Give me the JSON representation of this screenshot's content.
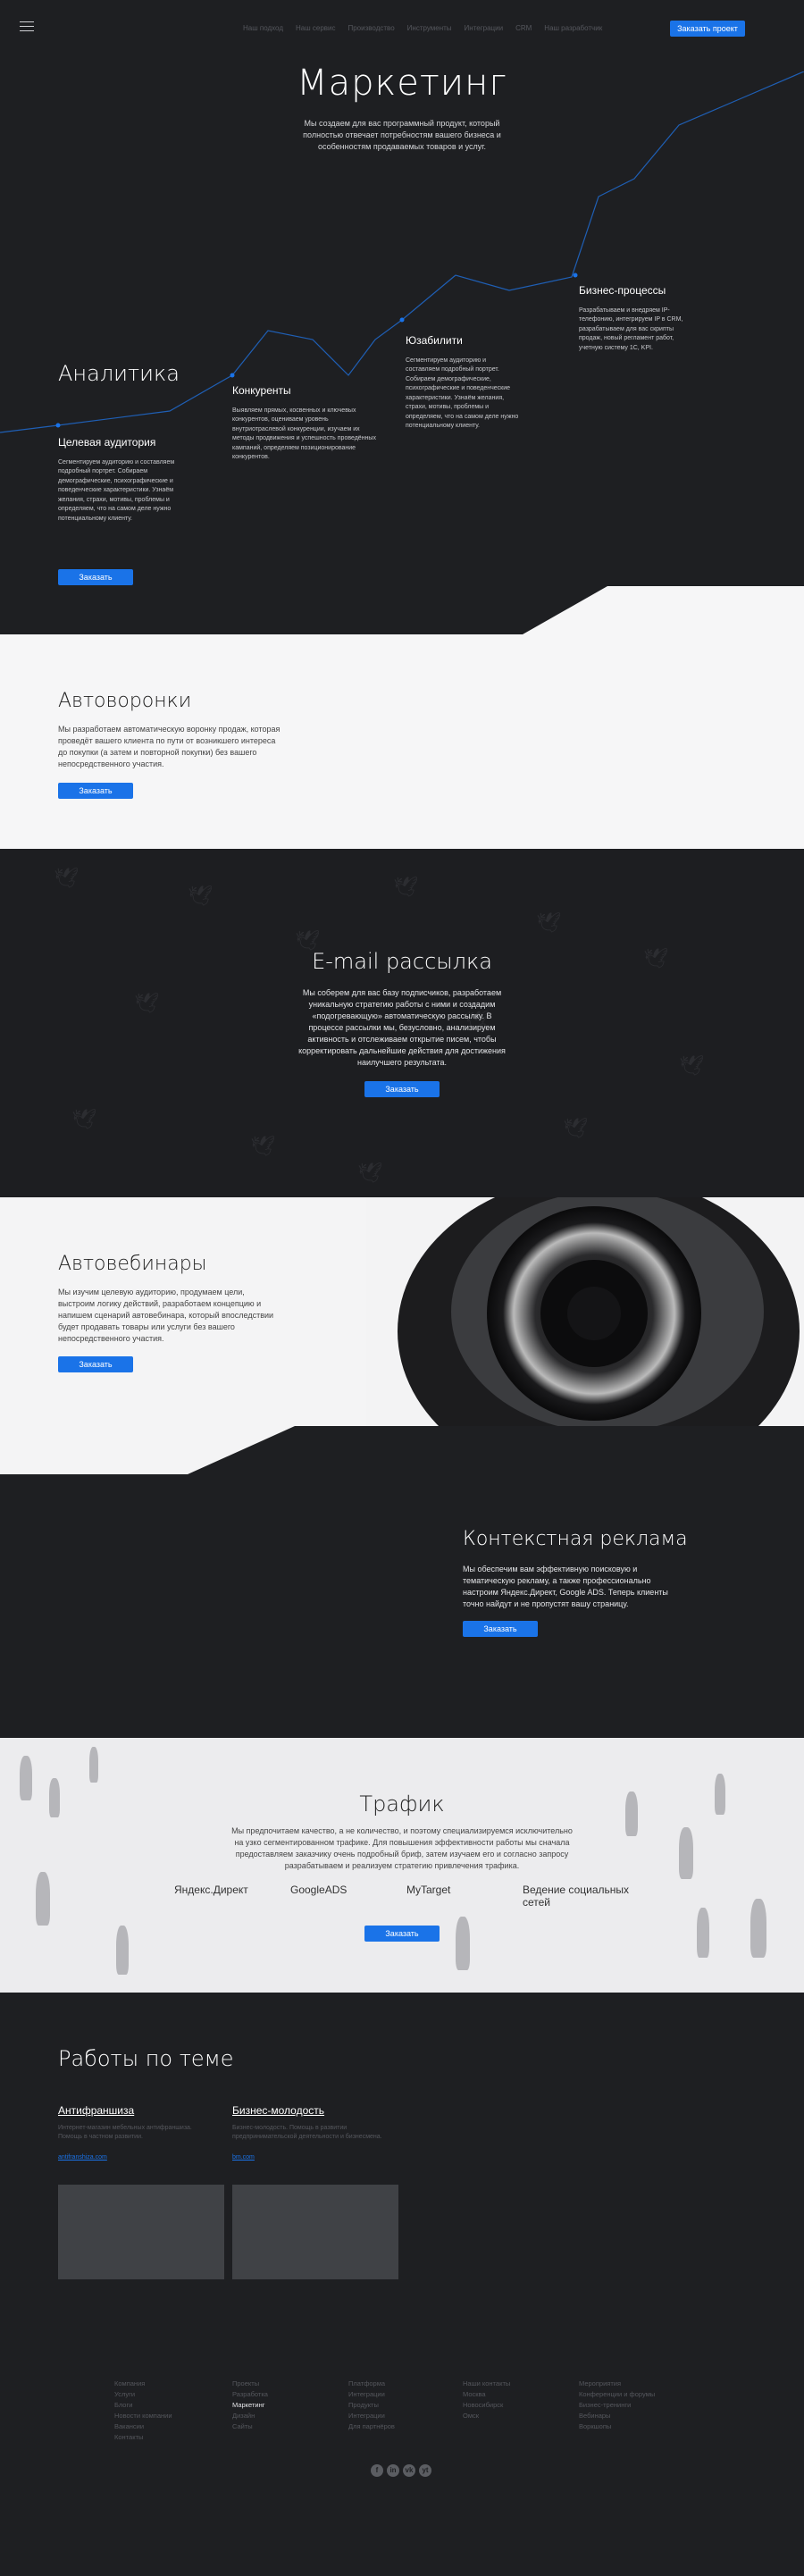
{
  "header": {
    "nav": [
      "Наш подход",
      "Наш сервис",
      "Производство",
      "Инструменты",
      "Интеграции",
      "CRM",
      "Наш разработчик"
    ],
    "order_label": "Заказать проект"
  },
  "hero": {
    "title": "Маркетинг",
    "subtitle": "Мы создаем для вас программный продукт, который полностью отвечает потребностям вашего бизнеса и особенностям продаваемых товаров и услуг.",
    "analytics_title": "Аналитика",
    "blocks": [
      {
        "title": "Целевая аудитория",
        "text": "Сегментируем аудиторию и составляем подробный портрет. Собираем демографические, психографические и поведенческие характеристики. Узнаём желания, страхи, мотивы, проблемы и определяем, что на самом деле нужно потенциальному клиенту."
      },
      {
        "title": "Конкуренты",
        "text": "Выявляем прямых, косвенных и ключевых конкурентов, оцениваем уровень внутриотраслевой конкуренции, изучаем их методы продвижения и успешность проведённых кампаний, определяем позиционирование конкурентов."
      },
      {
        "title": "Юзабилити",
        "text": "Сегментируем аудиторию и составляем подробный портрет. Собираем демографические, психографические и поведенческие характеристики. Узнаём желания, страхи, мотивы, проблемы и определяем, что на самом деле нужно потенциальному клиенту."
      },
      {
        "title": "Бизнес-процессы",
        "text": "Разрабатываем и внедряем IP-телефонию, интегрируем IP в CRM, разрабатываем для вас скрипты продаж, новый регламент работ, учетную систему 1С, KPI."
      }
    ],
    "order_label": "Заказать"
  },
  "funnel": {
    "title": "Автоворонки",
    "text": "Мы разработаем автоматическую воронку продаж, которая проведёт вашего клиента по пути от возникшего интереса до покупки (а затем и повторной покупки) без вашего непосредственного участия.",
    "order_label": "Заказать"
  },
  "email": {
    "title": "E-mail рассылка",
    "text": "Мы соберем для вас базу подписчиков, разработаем уникальную стратегию работы с ними и создадим «подогревающую» автоматическую рассылку. В процессе рассылки мы, безусловно, анализируем активность и отслеживаем открытие писем, чтобы корректировать дальнейшие действия для достижения наилучшего результата.",
    "order_label": "Заказать"
  },
  "webinar": {
    "title": "Автовебинары",
    "text": "Мы изучим целевую аудиторию, продумаем цели, выстроим логику действий, разработаем концепцию и напишем сценарий автовебинара, который впоследствии будет продавать товары или услуги без вашего непосредственного участия.",
    "order_label": "Заказать"
  },
  "context": {
    "title": "Контекстная реклама",
    "text": "Мы обеспечим вам эффективную поисковую и тематическую рекламу, а также профессионально настроим Яндекс.Директ, Google ADS. Теперь клиенты точно найдут и не пропустят вашу страницу.",
    "order_label": "Заказать"
  },
  "traffic": {
    "title": "Трафик",
    "text": "Мы предпочитаем качество, а не количество, и поэтому специализируемся исключительно на узко сегментированном трафике. Для повышения эффективности работы мы сначала предоставляем заказчику очень подробный бриф, затем изучаем его и согласно запросу разрабатываем и реализуем стратегию привлечения трафика.",
    "channels": [
      "Яндекс.Директ",
      "GoogleADS",
      "MyTarget",
      "Ведение социальных сетей"
    ],
    "order_label": "Заказать"
  },
  "works": {
    "title": "Работы по теме",
    "items": [
      {
        "title": "Антифраншиза",
        "desc": "Интернет-магазин мебельных антифраншиза. Помощь в частном развитии.",
        "link": "antifranshiza.com"
      },
      {
        "title": "Бизнес-молодость",
        "desc": "Бизнес-молодость. Помощь в развитии предпринимательской деятельности и бизнесмена.",
        "link": "bm.com"
      }
    ]
  },
  "footer": {
    "columns": [
      [
        "Компания",
        "Услуги",
        "Блоги",
        "Новости компании",
        "Вакансии",
        "Контакты"
      ],
      [
        "Проекты",
        "Разработка",
        "Маркетинг",
        "Дизайн",
        "Сайты"
      ],
      [
        "Платформа",
        "Интеграции",
        "Продукты",
        "Интеграции",
        "Для партнёров"
      ],
      [
        "Наши контакты",
        "Москва",
        "Новосибирск",
        "Омск"
      ],
      [
        "Мероприятия",
        "Конференции и форумы",
        "Бизнес-тренинги",
        "Вебинары",
        "Воркшопы"
      ]
    ],
    "social": [
      "f",
      "in",
      "vk",
      "yt"
    ]
  }
}
